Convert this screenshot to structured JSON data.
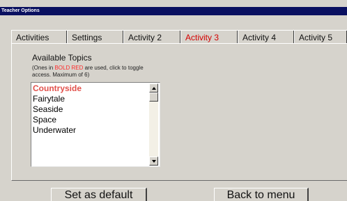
{
  "window": {
    "title": "Teacher Options"
  },
  "tabs": [
    {
      "label": "Activities",
      "selected": false
    },
    {
      "label": "Settings",
      "selected": false
    },
    {
      "label": "Activity 2",
      "selected": false
    },
    {
      "label": "Activity 3",
      "selected": true
    },
    {
      "label": "Activity 4",
      "selected": false
    },
    {
      "label": "Activity 5",
      "selected": false
    }
  ],
  "topics": {
    "heading": "Available Topics",
    "hint_prefix": "(Ones in ",
    "hint_highlight": "BOLD RED",
    "hint_suffix": " are used, click to toggle access. Maximum of 6)",
    "items": [
      {
        "label": "Countryside",
        "used": true
      },
      {
        "label": "Fairytale",
        "used": false
      },
      {
        "label": "Seaside",
        "used": false
      },
      {
        "label": "Space",
        "used": false
      },
      {
        "label": "Underwater",
        "used": false
      }
    ]
  },
  "buttons": {
    "set_default": "Set as default",
    "back_to_menu": "Back to menu"
  },
  "colors": {
    "titlebar": "#0a1060",
    "selected_tab_text": "#d40000",
    "used_topic": "#e2514b",
    "hint_highlight": "#ff2b2b",
    "background": "#d6d3cc"
  },
  "icons": {
    "scroll_up": "arrow-up-icon",
    "scroll_down": "arrow-down-icon"
  }
}
